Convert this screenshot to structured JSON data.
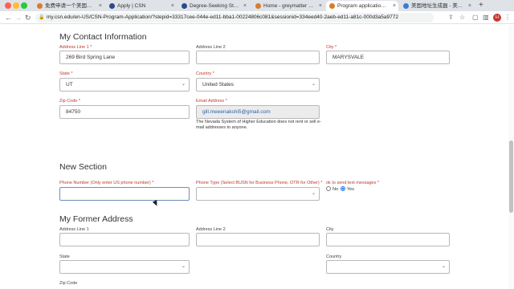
{
  "browser": {
    "tabs": [
      {
        "label": "免费申请一个美国edu学生邮",
        "active": false
      },
      {
        "label": "Apply | CSN",
        "active": false
      },
      {
        "label": "Degree-Seeking Students",
        "active": false
      },
      {
        "label": "Home - greymatter Portal",
        "active": false
      },
      {
        "label": "Program application | gre",
        "active": true
      },
      {
        "label": "美国地址生成器 - 美国身份",
        "active": false
      }
    ],
    "url": "my.csn.edu/en-US/CSN-Program-Application/?stepid=33317cee-044e-ed11-bba1-00224806c081&sessionid=334eed40-2aeb-ed11-a81c-000d3a5a9772",
    "profile_initial": "H"
  },
  "contact": {
    "title": "My Contact Information",
    "address1": {
      "label": "Address Line 1 *",
      "value": "269  Bird Spring Lane"
    },
    "address2": {
      "label": "Address Line 2",
      "value": ""
    },
    "city": {
      "label": "City *",
      "value": "MARYSVALE"
    },
    "state": {
      "label": "State *",
      "value": "UT"
    },
    "country": {
      "label": "Country *",
      "value": "United States"
    },
    "zip": {
      "label": "Zip Code *",
      "value": "84750"
    },
    "email": {
      "label": "Email Address *",
      "value": "gill.meeenakshi5@gmail.com"
    },
    "email_note": "The Nevada System of Higher Education does not rent or sell e-mail addresses to anyone."
  },
  "new_section": {
    "title": "New Section",
    "phone_number": {
      "label": "Phone Number (Only enter US phone number) *",
      "value": ""
    },
    "phone_type": {
      "label": "Phone Type (Select BUSN for Business Phone, OTR for Other) *",
      "value": ""
    },
    "ok_to_text": {
      "label": "ok to send text messages *",
      "no": "No",
      "yes": "Yes",
      "selected": "Yes"
    }
  },
  "former": {
    "title": "My Former Address",
    "address1": {
      "label": "Address Line 1",
      "value": ""
    },
    "address2": {
      "label": "Address Line 2",
      "value": ""
    },
    "city": {
      "label": "City",
      "value": ""
    },
    "state": {
      "label": "State",
      "value": ""
    },
    "country": {
      "label": "Country",
      "value": ""
    },
    "zip": {
      "label": "Zip Code",
      "value": ""
    }
  },
  "colors": {
    "required_label": "#c0392b",
    "email_text": "#2a62a8",
    "radio_selected": "#1a73e8"
  }
}
